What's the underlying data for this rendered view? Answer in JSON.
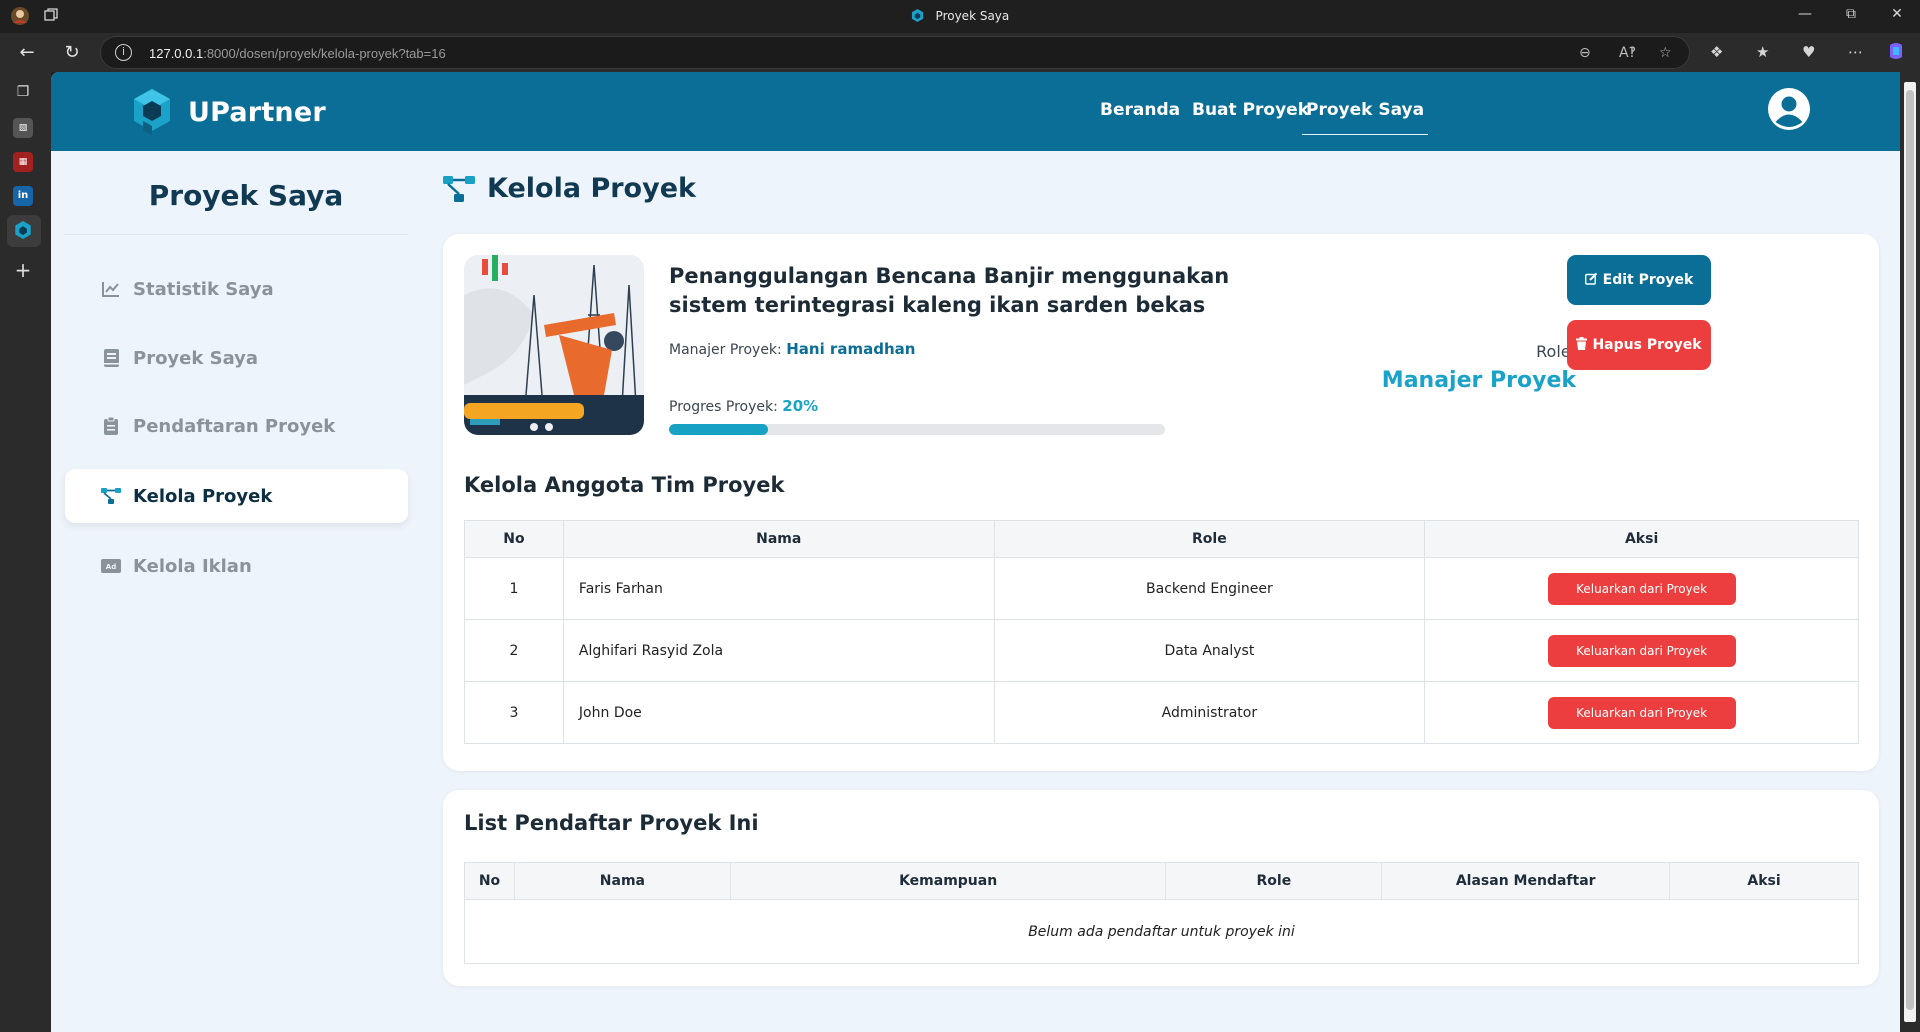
{
  "browser": {
    "tab_title": "Proyek Saya",
    "url_host": "127.0.0.1",
    "url_rest": ":8000/dosen/proyek/kelola-proyek?tab=16"
  },
  "nav": {
    "brand": "UPartner",
    "links": [
      "Beranda",
      "Buat Proyek",
      "Proyek Saya"
    ],
    "active": "Proyek Saya"
  },
  "sidebar": {
    "title": "Proyek Saya",
    "items": [
      {
        "label": "Statistik Saya",
        "icon": "chart-line-icon"
      },
      {
        "label": "Proyek Saya",
        "icon": "book-icon"
      },
      {
        "label": "Pendaftaran Proyek",
        "icon": "clipboard-icon"
      },
      {
        "label": "Kelola Proyek",
        "icon": "project-diagram-icon",
        "active": true
      },
      {
        "label": "Kelola Iklan",
        "icon": "ad-icon"
      }
    ]
  },
  "main": {
    "title": "Kelola Proyek",
    "project": {
      "title": "Penanggulangan Bencana Banjir menggunakan sistem terintegrasi kaleng ikan sarden bekas",
      "manager_label": "Manajer Proyek:",
      "manager_name": "Hani ramadhan",
      "progress_label": "Progres Proyek:",
      "progress_text": "20%",
      "progress_value": 0.2,
      "role_label": "Role:",
      "role_value": "Manajer Proyek",
      "edit_button": "Edit Proyek",
      "delete_button": "Hapus Proyek"
    },
    "team": {
      "title": "Kelola Anggota Tim Proyek",
      "columns": [
        "No",
        "Nama",
        "Role",
        "Aksi"
      ],
      "rows": [
        {
          "no": "1",
          "nama": "Faris Farhan",
          "role": "Backend Engineer",
          "aksi": "Keluarkan dari Proyek"
        },
        {
          "no": "2",
          "nama": "Alghifari Rasyid Zola",
          "role": "Data Analyst",
          "aksi": "Keluarkan dari Proyek"
        },
        {
          "no": "3",
          "nama": "John Doe",
          "role": "Administrator",
          "aksi": "Keluarkan dari Proyek"
        }
      ]
    },
    "applicants": {
      "title": "List Pendaftar Proyek Ini",
      "columns": [
        "No",
        "Nama",
        "Kemampuan",
        "Role",
        "Alasan Mendaftar",
        "Aksi"
      ],
      "empty_text": "Belum ada pendaftar untuk proyek ini"
    }
  },
  "colors": {
    "primary": "#0a6e96",
    "accent": "#17a2c4",
    "danger": "#ec3e3e",
    "page_bg": "#eef4fb"
  }
}
